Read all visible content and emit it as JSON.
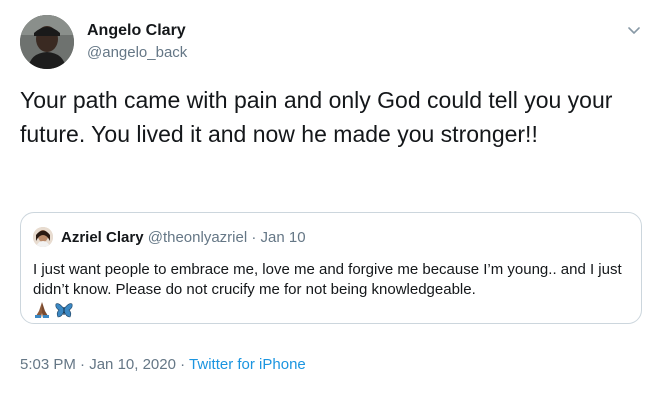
{
  "author": {
    "name": "Angelo Clary",
    "handle": "@angelo_back"
  },
  "tweet_text": "Your path came with pain and only God could tell you your future. You lived it and now he made you stronger!!",
  "quoted": {
    "name": "Azriel Clary",
    "handle": "@theonlyazriel",
    "separator": " · ",
    "date": "Jan 10",
    "text": "I just want people to embrace me, love me and forgive me because I’m young.. and I just didn’t know. Please do not crucify me for not being knowledgeable.",
    "emojis": [
      "praying-hands",
      "butterfly"
    ]
  },
  "meta": {
    "time": "5:03 PM",
    "sep1": " · ",
    "date": "Jan 10, 2020",
    "sep2": " · ",
    "source": "Twitter for iPhone"
  },
  "icons": {
    "caret": "chevron-down-icon"
  },
  "colors": {
    "text": "#14171a",
    "secondary": "#657786",
    "link": "#1b95e0",
    "border": "#ccd6dd"
  }
}
